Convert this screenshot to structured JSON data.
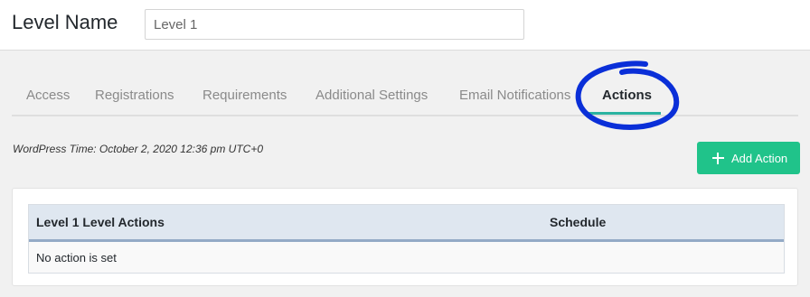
{
  "header": {
    "level_label": "Level Name",
    "level_value": "Level 1"
  },
  "tabs": [
    {
      "label": "Access",
      "active": false
    },
    {
      "label": "Registrations",
      "active": false
    },
    {
      "label": "Requirements",
      "active": false
    },
    {
      "label": "Additional Settings",
      "active": false
    },
    {
      "label": "Email Notifications",
      "active": false
    },
    {
      "label": "Actions",
      "active": true
    }
  ],
  "wp_time": "WordPress Time: October 2, 2020 12:36 pm UTC+0",
  "add_action_label": "Add Action",
  "table": {
    "columns": [
      "Level 1 Level Actions",
      "Schedule"
    ],
    "empty_message": "No action is set"
  },
  "colors": {
    "accent_green": "#20c38a",
    "tab_underline": "#2bb3a1",
    "annotation_blue": "#0a2fd8",
    "table_header_bg": "#dfe7f0"
  }
}
